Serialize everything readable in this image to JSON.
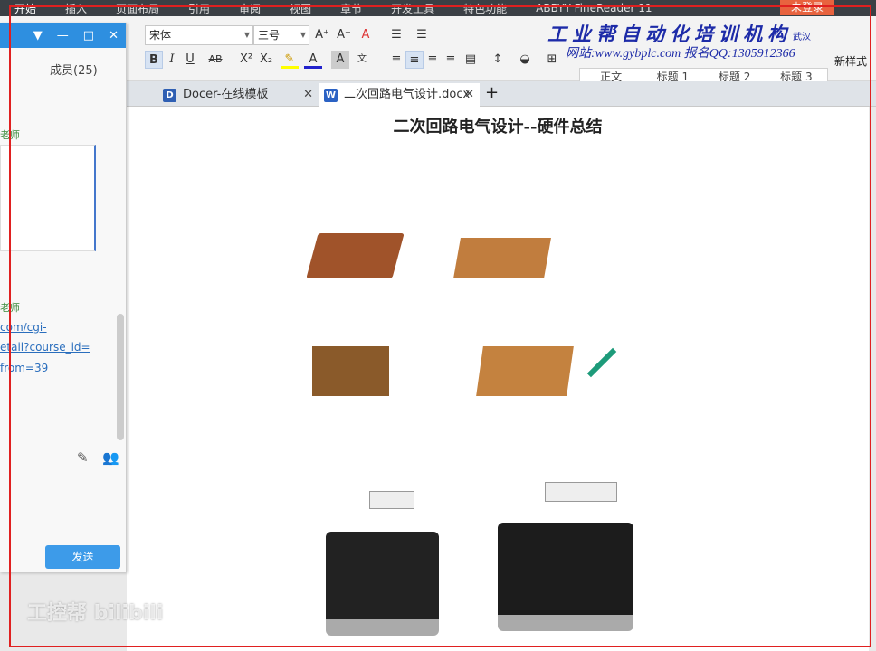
{
  "menu": [
    "开始",
    "插入",
    "页面布局",
    "引用",
    "审阅",
    "视图",
    "章节",
    "开发工具",
    "特色功能",
    "ABBYY FineReader 11"
  ],
  "login": "未登录",
  "ribbon": {
    "font": "宋体",
    "size": "三号",
    "styles": [
      "正文",
      "标题 1",
      "标题 2",
      "标题 3"
    ],
    "new_style": "新样式"
  },
  "watermark": {
    "line1": "工业帮自动化培训机构",
    "line2": "网站:www.gybplc.com  报名QQ:1305912366",
    "city": "武汉"
  },
  "tabs": [
    {
      "label": "Docer-在线模板",
      "icon": "D"
    },
    {
      "label": "二次回路电气设计.docx",
      "icon": "W"
    }
  ],
  "doc": {
    "title": "二次回路电气设计--硬件总结"
  },
  "chat": {
    "members": "成员(25)",
    "sender1": "老师",
    "sender2": "老师",
    "link": [
      "com/cgi-",
      "etail?course_id=",
      "from=39"
    ],
    "send": "发送"
  },
  "overlay": "工控帮 bilibili"
}
